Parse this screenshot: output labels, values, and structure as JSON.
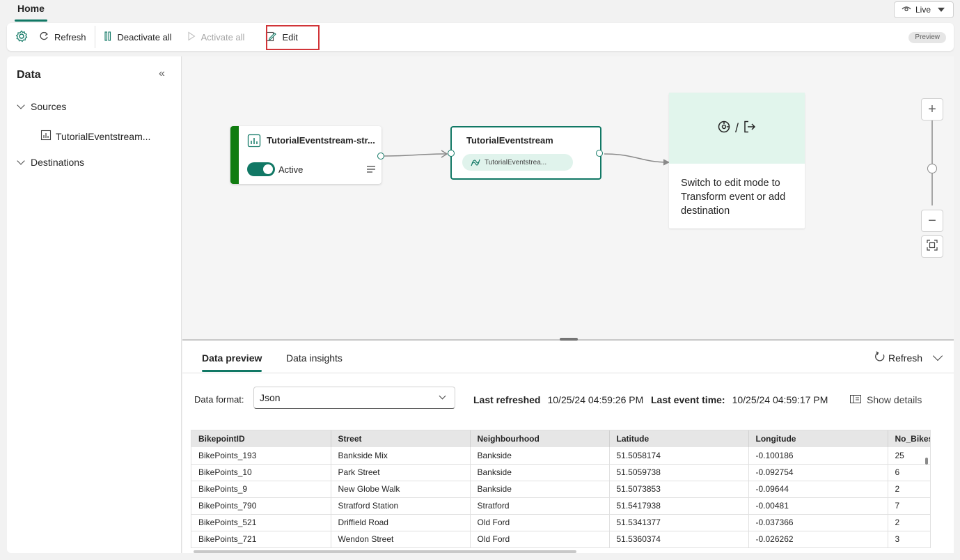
{
  "topbar": {
    "home_tab": "Home",
    "live_label": "Live"
  },
  "toolbar": {
    "refresh": "Refresh",
    "deactivate_all": "Deactivate all",
    "activate_all": "Activate all",
    "edit": "Edit",
    "preview_badge": "Preview"
  },
  "left_panel": {
    "title": "Data",
    "sources_label": "Sources",
    "source_item": "TutorialEventstream...",
    "destinations_label": "Destinations"
  },
  "canvas": {
    "source_node": {
      "name": "TutorialEventstream-str...",
      "status": "Active"
    },
    "eventstream_node": {
      "name": "TutorialEventstream",
      "stream_pill": "TutorialEventstrea..."
    },
    "destination_node": {
      "separator": "/",
      "message": "Switch to edit mode to Transform event or add destination"
    }
  },
  "bottom_panel": {
    "tabs": [
      "Data preview",
      "Data insights"
    ],
    "refresh": "Refresh",
    "data_format_label": "Data format:",
    "data_format_value": "Json",
    "last_refreshed_label": "Last refreshed",
    "last_refreshed_value": "10/25/24 04:59:26 PM",
    "last_event_label": "Last event time:",
    "last_event_value": "10/25/24 04:59:17 PM",
    "show_details": "Show details"
  },
  "table": {
    "columns": [
      "BikepointID",
      "Street",
      "Neighbourhood",
      "Latitude",
      "Longitude",
      "No_Bikes"
    ],
    "rows": [
      [
        "BikePoints_193",
        "Bankside Mix",
        "Bankside",
        "51.5058174",
        "-0.100186",
        "25"
      ],
      [
        "BikePoints_10",
        "Park Street",
        "Bankside",
        "51.5059738",
        "-0.092754",
        "6"
      ],
      [
        "BikePoints_9",
        "New Globe Walk",
        "Bankside",
        "51.5073853",
        "-0.09644",
        "2"
      ],
      [
        "BikePoints_790",
        "Stratford Station",
        "Stratford",
        "51.5417938",
        "-0.00481",
        "7"
      ],
      [
        "BikePoints_521",
        "Driffield Road",
        "Old Ford",
        "51.5341377",
        "-0.037366",
        "2"
      ],
      [
        "BikePoints_721",
        "Wendon Street",
        "Old Ford",
        "51.5360374",
        "-0.026262",
        "3"
      ]
    ]
  },
  "colors": {
    "accent": "#117865",
    "source_bar": "#107c10",
    "edit_highlight": "#d13438",
    "dest_header": "#e1f5ec"
  }
}
